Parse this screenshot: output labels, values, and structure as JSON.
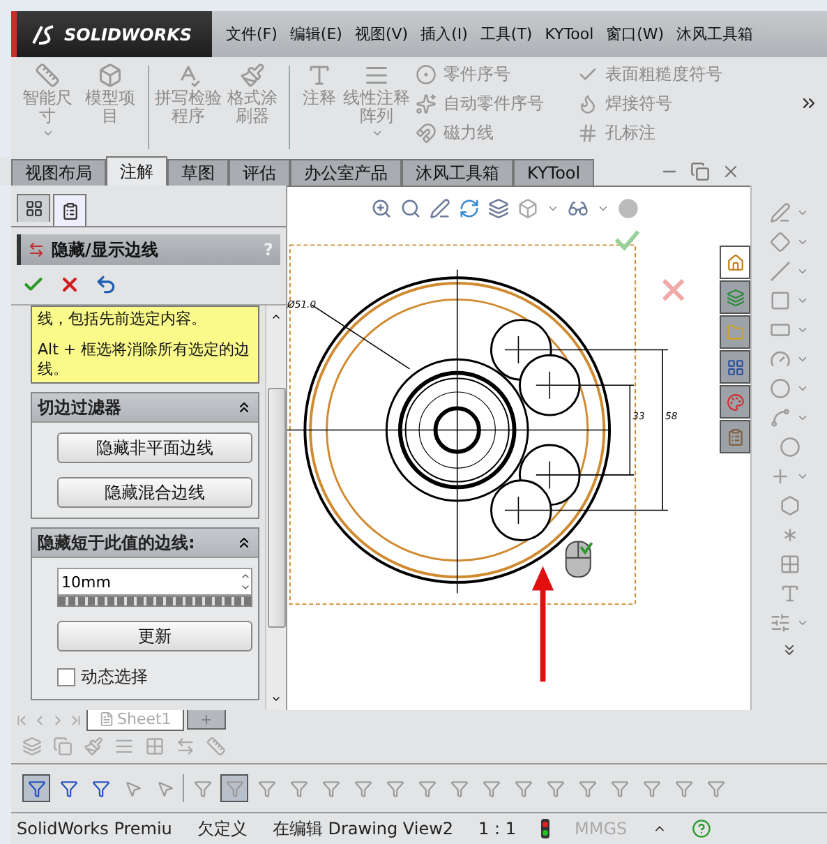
{
  "app": {
    "logo": "SOLIDWORKS"
  },
  "menu": [
    "文件(F)",
    "编辑(E)",
    "视图(V)",
    "插入(I)",
    "工具(T)",
    "KYTool",
    "窗口(W)",
    "沐风工具箱"
  ],
  "ribbon": {
    "large_tools": [
      {
        "label": "智能尺寸",
        "dropdown": true,
        "disabled": true
      },
      {
        "label": "模型项目",
        "dropdown": false,
        "disabled": true
      },
      {
        "label": "拼写检验程序",
        "dropdown": false,
        "disabled": true
      },
      {
        "label": "格式涂刷器",
        "dropdown": false,
        "disabled": true
      },
      {
        "label": "注释",
        "dropdown": false,
        "disabled": true
      },
      {
        "label": "线性注释阵列",
        "dropdown": true,
        "disabled": true
      }
    ],
    "small_tools": [
      {
        "label": "零件序号",
        "disabled": true
      },
      {
        "label": "自动零件序号",
        "disabled": true
      },
      {
        "label": "磁力线",
        "disabled": true
      },
      {
        "label": "表面粗糙度符号",
        "disabled": true
      },
      {
        "label": "焊接符号",
        "disabled": true
      },
      {
        "label": "孔标注",
        "disabled": true
      }
    ]
  },
  "tabs": [
    {
      "label": "视图布局",
      "selected": false
    },
    {
      "label": "注解",
      "selected": true
    },
    {
      "label": "草图",
      "selected": false
    },
    {
      "label": "评估",
      "selected": false
    },
    {
      "label": "办公室产品",
      "selected": false
    },
    {
      "label": "沐风工具箱",
      "selected": false
    },
    {
      "label": "KYTool",
      "selected": false
    }
  ],
  "property_manager": {
    "tabs": [
      {
        "selected": false
      },
      {
        "selected": true
      }
    ],
    "title": "隐藏/显示边线",
    "help": "?",
    "message": [
      "线，包括先前选定内容。",
      "Alt + 框选将消除所有选定的边线。"
    ],
    "sections": [
      {
        "title": "切边过滤器",
        "expanded": true,
        "buttons": [
          "隐藏非平面边线",
          "隐藏混合边线"
        ]
      },
      {
        "title": "隐藏短于此值的边线:",
        "expanded": true,
        "field": {
          "value": "10mm"
        },
        "buttons": [
          "更新"
        ],
        "checkbox": {
          "label": "动态选择",
          "checked": false
        }
      }
    ]
  },
  "drawing": {
    "labels": [
      "Ø51.0",
      "33",
      "58"
    ]
  },
  "task_pane": [
    {
      "selected": true
    },
    {
      "selected": false
    },
    {
      "selected": false
    },
    {
      "selected": false
    },
    {
      "selected": false
    },
    {
      "selected": false
    }
  ],
  "sheet_tabs": [
    {
      "label": "Sheet1",
      "selected": true
    }
  ],
  "filter_toolbar": [
    {
      "selected": true
    },
    {
      "selected": false
    },
    {
      "selected": false
    },
    {
      "selected": false
    },
    {
      "selected": false
    },
    {
      "selected": false
    },
    {
      "selected": true
    },
    {
      "selected": false
    },
    {
      "selected": false
    },
    {
      "selected": false
    },
    {
      "selected": false
    },
    {
      "selected": false
    },
    {
      "selected": false
    },
    {
      "selected": false
    },
    {
      "selected": false
    },
    {
      "selected": false
    },
    {
      "selected": false
    },
    {
      "selected": false
    },
    {
      "selected": false
    },
    {
      "selected": false
    },
    {
      "selected": false
    },
    {
      "selected": false
    }
  ],
  "status_bar": [
    "SolidWorks Premiu",
    "欠定义",
    "在编辑 Drawing View2",
    "1 : 1",
    "MMGS"
  ]
}
